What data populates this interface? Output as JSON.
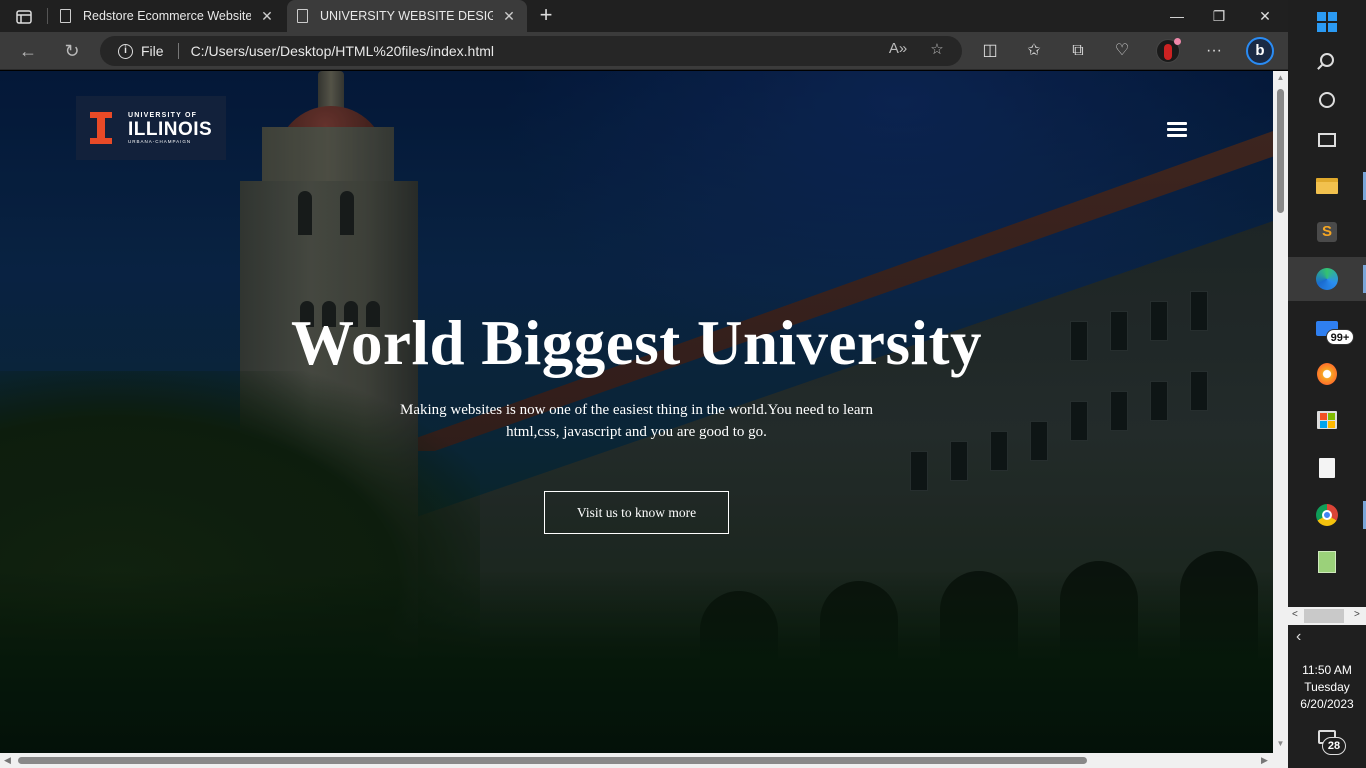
{
  "browser": {
    "tabs": [
      {
        "title": "Redstore Ecommerce Website de",
        "active": false
      },
      {
        "title": "UNIVERSITY WEBSITE DESIGHN",
        "active": true
      }
    ],
    "address": {
      "scheme_label": "File",
      "url": "C:/Users/user/Desktop/HTML%20files/index.html"
    }
  },
  "site": {
    "logo": {
      "line1": "UNIVERSITY OF",
      "line2": "ILLINOIS",
      "line3": "URBANA-CHAMPAIGN",
      "brand_color": "#e84a27"
    },
    "hero": {
      "title": "World Biggest University",
      "subtitle": "Making websites is now one of the easiest thing in the world.You need to learn html,css, javascript and you are good to go.",
      "cta_label": "Visit us to know more"
    }
  },
  "taskbar": {
    "items": [
      "windows-start",
      "search",
      "cortana",
      "task-view",
      "file-explorer",
      "sublime-text",
      "microsoft-edge",
      "mail",
      "brave",
      "microsoft-store",
      "file",
      "google-chrome",
      "notepad"
    ],
    "mail_badge": "99+",
    "time": "11:50 AM",
    "day": "Tuesday",
    "date": "6/20/2023",
    "notification_count": "28"
  }
}
